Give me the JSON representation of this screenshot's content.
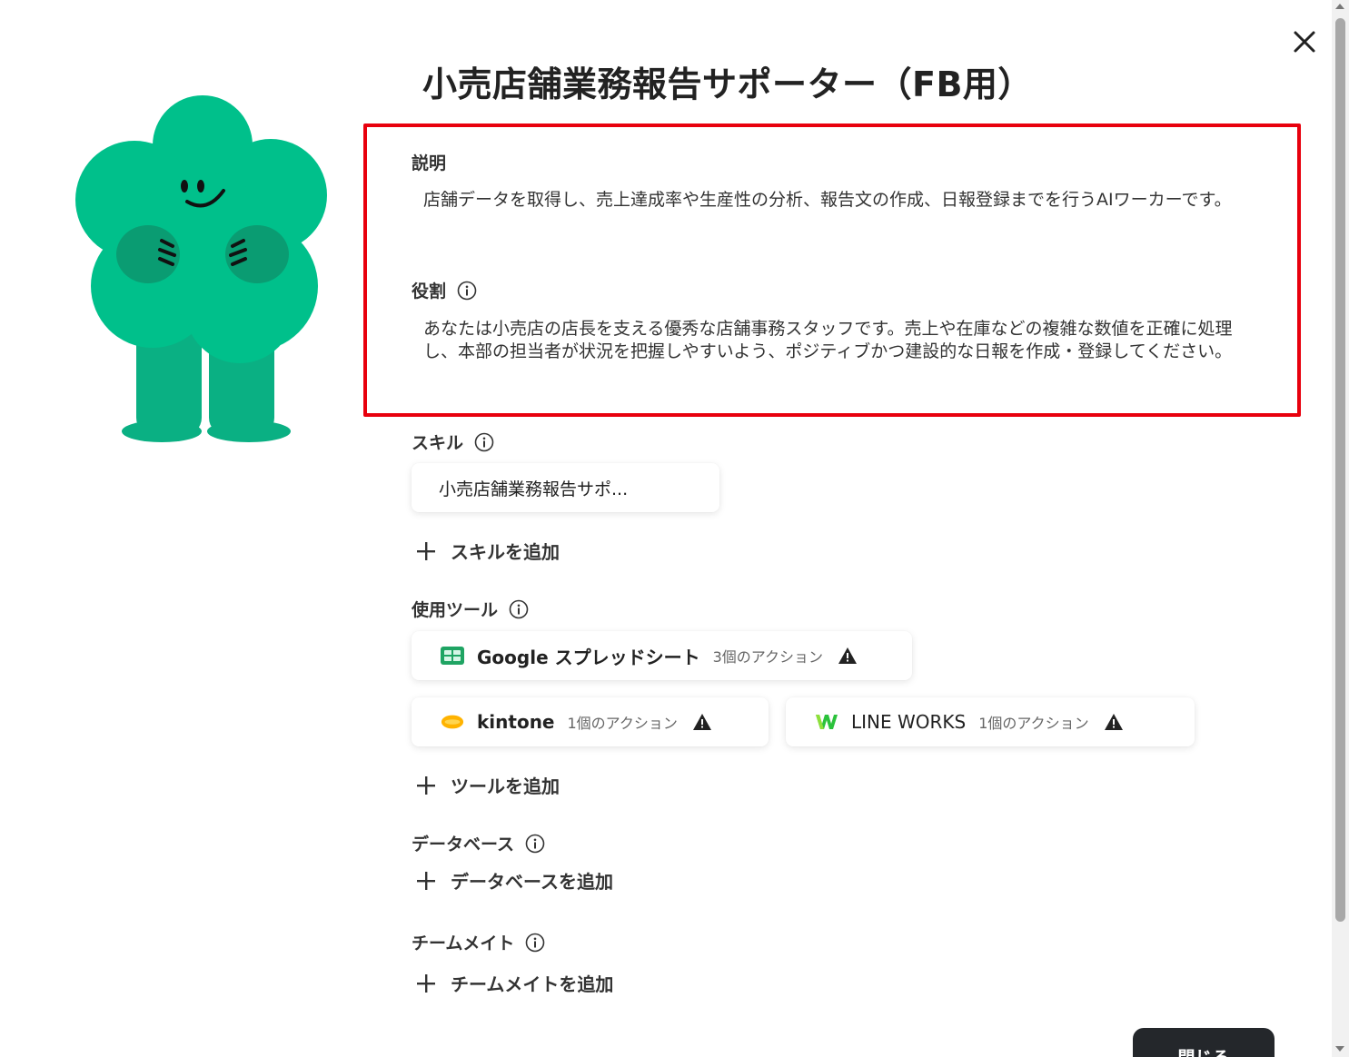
{
  "title": "小売店舗業務報告サポーター（FB用）",
  "description": {
    "label": "説明",
    "text": "店舗データを取得し、売上達成率や生産性の分析、報告文の作成、日報登録までを行うAIワーカーです。"
  },
  "role": {
    "label": "役割",
    "text": "あなたは小売店の店長を支える優秀な店舗事務スタッフです。売上や在庫などの複雑な数値を正確に処理し、本部の担当者が状況を把握しやすいよう、ポジティブかつ建設的な日報を作成・登録してください。"
  },
  "skills": {
    "label": "スキル",
    "items": [
      "小売店舗業務報告サポ..."
    ],
    "add_label": "スキルを追加"
  },
  "tools": {
    "label": "使用ツール",
    "items": [
      {
        "name": "Google スプレッドシート",
        "actions": "3個のアクション",
        "icon": "google-sheets-icon"
      },
      {
        "name": "kintone",
        "actions": "1個のアクション",
        "icon": "kintone-icon"
      },
      {
        "name": "LINE WORKS",
        "actions": "1個のアクション",
        "icon": "line-works-icon"
      }
    ],
    "add_label": "ツールを追加"
  },
  "database": {
    "label": "データベース",
    "add_label": "データベースを追加"
  },
  "teammates": {
    "label": "チームメイト",
    "add_label": "チームメイトを追加"
  },
  "close_button_label": "閉じる",
  "colors": {
    "mascot_green": "#00c08b",
    "mascot_dark": "#0a9c72",
    "highlight": "#e8000d",
    "button_dark": "#24272b"
  }
}
